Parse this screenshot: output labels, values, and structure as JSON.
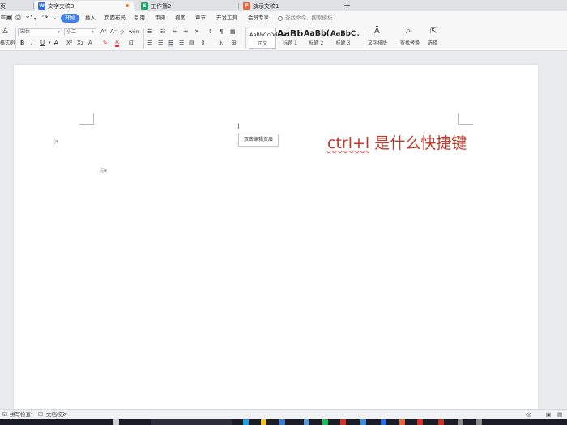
{
  "tabs": [
    {
      "label": "页",
      "icon": ""
    },
    {
      "label": "文字文稿3",
      "icon": "W"
    },
    {
      "label": "工作簿2",
      "icon": "S"
    },
    {
      "label": "演示文稿1",
      "icon": "P"
    }
  ],
  "tab_add": "+",
  "quick_access": [
    "⎙",
    "⟲",
    "▾",
    "⌄"
  ],
  "menu": {
    "start": "开始",
    "items": [
      "插入",
      "页面布局",
      "引用",
      "审阅",
      "视图",
      "章节",
      "开发工具",
      "会员专享"
    ],
    "search_placeholder": "查找命令、搜索模板"
  },
  "ribbon": {
    "format_painter": "格式刷",
    "font_name": "宋体",
    "font_size": "小二",
    "bold": "B",
    "italic": "I",
    "underline": "U",
    "font_btns": [
      "A⁺",
      "A⁻",
      "◇",
      "wén"
    ],
    "styles": [
      {
        "sample": "AaBbCcDd",
        "name": "正文"
      },
      {
        "sample": "AaBb",
        "name": "标题 1"
      },
      {
        "sample": "AaBb(",
        "name": "标题 2"
      },
      {
        "sample": "AaBbC",
        "name": "标题 3"
      }
    ],
    "text_layout": "文字排版",
    "find_replace": "查找替换",
    "select": "选择"
  },
  "document": {
    "header_tip": "双击编辑页眉",
    "content_prefix": "ctrl+l",
    "content_rest": " 是什么快捷键"
  },
  "status": {
    "spellcheck": "拼写检查",
    "proofread": "文档校对"
  },
  "colors": {
    "accent": "#3f7fe8",
    "doc_text": "#c0392b",
    "wps_writer": "#2d6be0",
    "wps_sheet": "#22a16b",
    "wps_present": "#e8643b"
  }
}
